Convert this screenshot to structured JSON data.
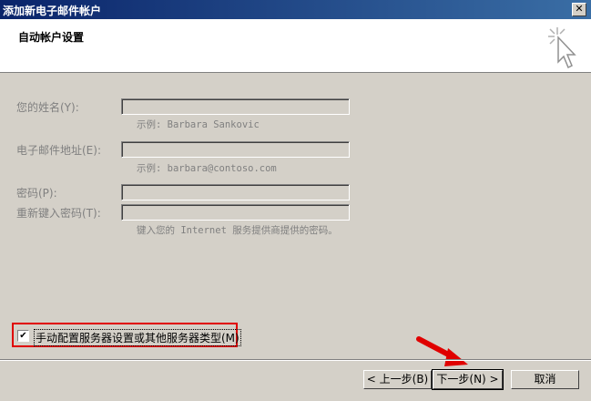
{
  "window": {
    "title": "添加新电子邮件帐户",
    "close_glyph": "✕"
  },
  "header": {
    "title": "自动帐户设置",
    "icon": "cursor-sparkle-icon"
  },
  "form": {
    "name_label": "您的姓名(Y):",
    "name_value": "",
    "name_hint": "示例: Barbara Sankovic",
    "email_label": "电子邮件地址(E):",
    "email_value": "",
    "email_hint": "示例: barbara@contoso.com",
    "password_label": "密码(P):",
    "password_value": "",
    "retype_label": "重新键入密码(T):",
    "retype_value": "",
    "password_hint": "键入您的 Internet 服务提供商提供的密码。"
  },
  "manual_config": {
    "label": "手动配置服务器设置或其他服务器类型(M)",
    "checked": true,
    "check_glyph": "✔"
  },
  "buttons": {
    "back": "< 上一步(B)",
    "next": "下一步(N) >",
    "cancel": "取消"
  },
  "colors": {
    "highlight_border": "#e00000",
    "arrow": "#e00000"
  }
}
